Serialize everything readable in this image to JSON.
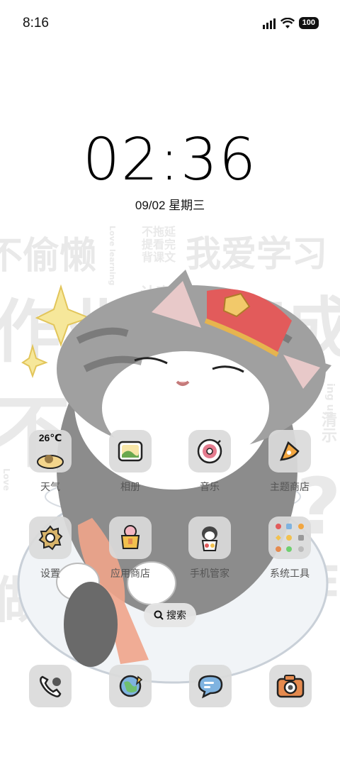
{
  "status_bar": {
    "time": "8:16",
    "battery": "100"
  },
  "clock": {
    "time": "02:36",
    "date": "09/02 星期三"
  },
  "wallpaper": {
    "texts": [
      "不偷懒",
      "Love learning",
      "不拖延 提看完 背课文",
      "我爱学习",
      "认真",
      "作业",
      "完成",
      "不",
      "Love",
      "?",
      "ing up",
      "清示",
      "作业",
      "做"
    ]
  },
  "apps": [
    {
      "label": "天气",
      "icon": "weather-icon",
      "badge": "26℃"
    },
    {
      "label": "相册",
      "icon": "gallery-icon"
    },
    {
      "label": "音乐",
      "icon": "music-icon"
    },
    {
      "label": "主题商店",
      "icon": "theme-store-icon"
    },
    {
      "label": "设置",
      "icon": "settings-icon"
    },
    {
      "label": "应用商店",
      "icon": "app-store-icon"
    },
    {
      "label": "手机管家",
      "icon": "phone-manager-icon"
    },
    {
      "label": "系统工具",
      "icon": "system-tools-folder-icon"
    }
  ],
  "search": {
    "label": "搜索"
  },
  "dock": [
    {
      "icon": "phone-icon"
    },
    {
      "icon": "browser-icon"
    },
    {
      "icon": "messages-icon"
    },
    {
      "icon": "camera-icon"
    }
  ]
}
